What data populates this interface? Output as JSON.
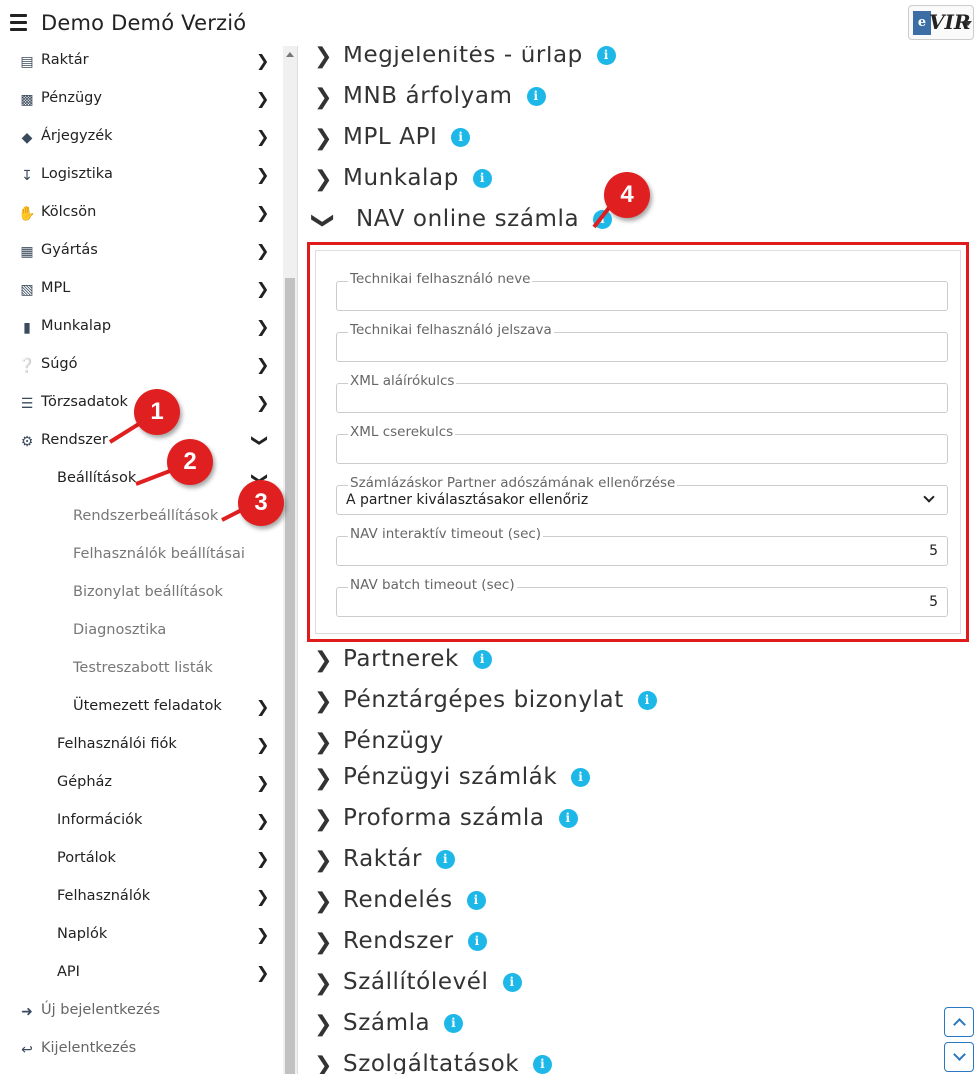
{
  "header": {
    "title": "Demo Demó Verzió",
    "logo_e": "e",
    "logo_vir": "VIR"
  },
  "sidebar": {
    "items": [
      {
        "label": "Raktár",
        "icon": "warehouse-icon"
      },
      {
        "label": "Pénzügy",
        "icon": "money-icon"
      },
      {
        "label": "Árjegyzék",
        "icon": "tags-icon"
      },
      {
        "label": "Logisztika",
        "icon": "dolly-icon"
      },
      {
        "label": "Kölcsön",
        "icon": "hand-holding-icon"
      },
      {
        "label": "Gyártás",
        "icon": "cubes-icon"
      },
      {
        "label": "MPL",
        "icon": "pallet-icon"
      },
      {
        "label": "Munkalap",
        "icon": "file-icon"
      },
      {
        "label": "Súgó",
        "icon": "question-circle-icon"
      },
      {
        "label": "Törzsadatok",
        "icon": "database-icon"
      },
      {
        "label": "Rendszer",
        "icon": "cogs-icon"
      }
    ],
    "beallitasok": "Beállítások",
    "sub": [
      "Rendszerbeállítások",
      "Felhasználók beállításai",
      "Bizonylat beállítások",
      "Diagnosztika",
      "Testreszabott listák",
      "Ütemezett feladatok"
    ],
    "level1": [
      "Felhasználói fiók",
      "Gépház",
      "Információk",
      "Portálok",
      "Felhasználók",
      "Naplók",
      "API"
    ],
    "new_login": "Új bejelentkezés",
    "logout": "Kijelentkezés"
  },
  "sections_above": [
    "Megjelenítés - űrlap",
    "MNB árfolyam",
    "MPL API",
    "Munkalap"
  ],
  "expanded_section": "NAV online számla",
  "form": {
    "tech_user_label": "Technikai felhasználó neve",
    "tech_pass_label": "Technikai felhasználó jelszava",
    "xml_sign_label": "XML aláírókulcs",
    "xml_exchange_label": "XML cserekulcs",
    "partner_check_label": "Számlázáskor Partner adószámának ellenőrzése",
    "partner_check_value": "A partner kiválasztásakor ellenőriz",
    "interactive_timeout_label": "NAV interaktív timeout (sec)",
    "interactive_timeout_value": "5",
    "batch_timeout_label": "NAV batch timeout (sec)",
    "batch_timeout_value": "5"
  },
  "sections_below": [
    "Partnerek",
    "Pénztárgépes bizonylat",
    "Pénzügy",
    "Pénzügyi számlák",
    "Proforma számla",
    "Raktár",
    "Rendelés",
    "Rendszer",
    "Szállítólevél",
    "Számla",
    "Szolgáltatások"
  ],
  "info_glyph": "i",
  "callouts": [
    "1",
    "2",
    "3",
    "4"
  ],
  "colors": {
    "accent_red": "#e02020",
    "info_blue": "#1eb8e8",
    "button_blue": "#2b78c2"
  }
}
